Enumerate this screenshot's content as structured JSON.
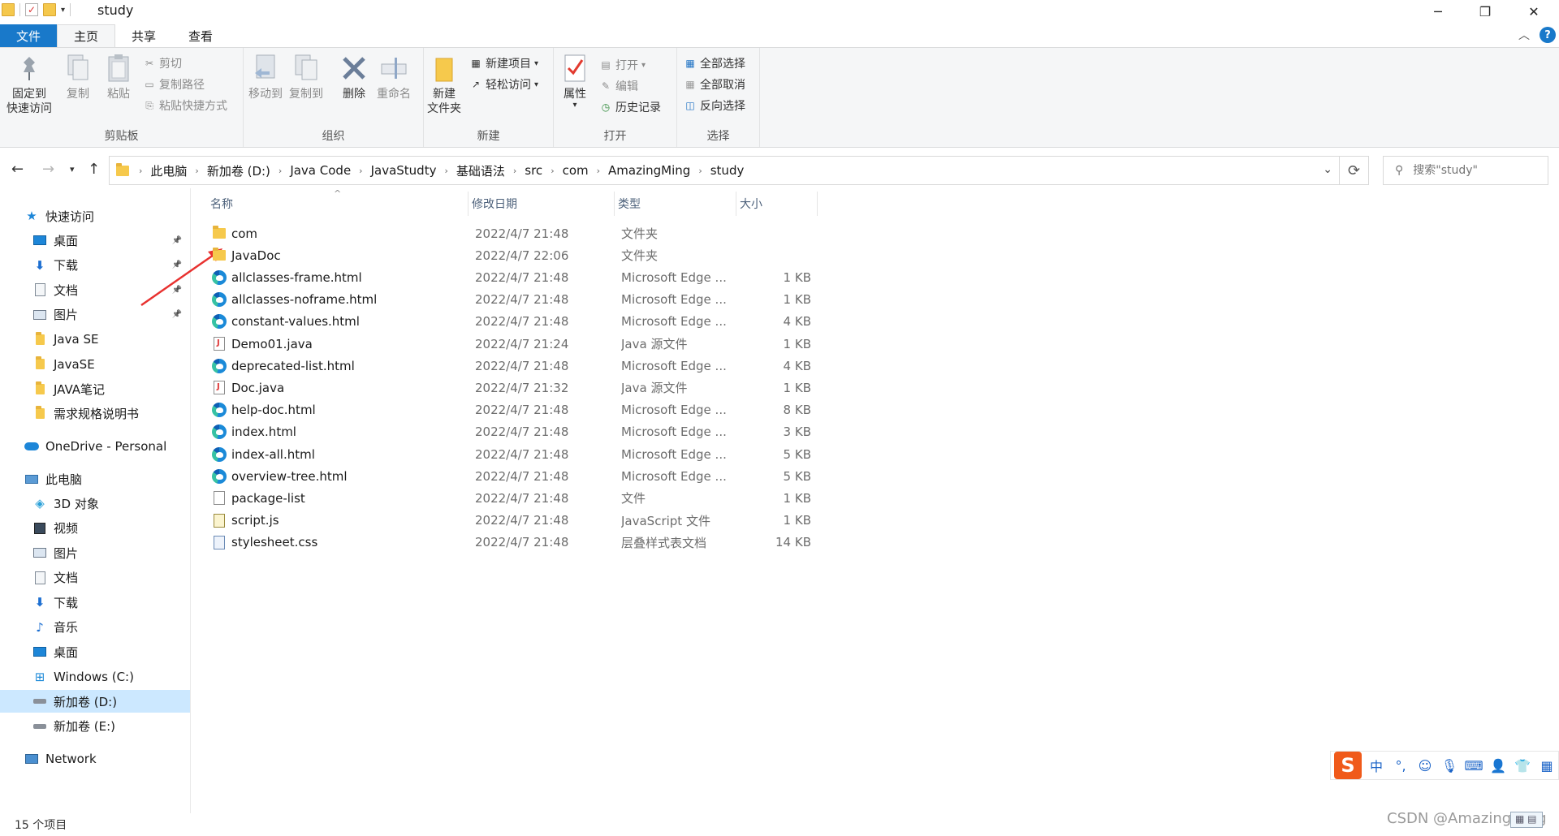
{
  "window": {
    "title": "study",
    "qa_arrow": "▾",
    "minimize": "─",
    "restore": "❐",
    "close": "✕"
  },
  "tabs": {
    "file": "文件",
    "home": "主页",
    "share": "共享",
    "view": "查看"
  },
  "ribbon": {
    "clipboard": {
      "label": "剪贴板",
      "pin_line1": "固定到",
      "pin_line2": "快速访问",
      "copy": "复制",
      "paste": "粘贴",
      "cut": "剪切",
      "copy_path": "复制路径",
      "paste_shortcut": "粘贴快捷方式"
    },
    "organize": {
      "label": "组织",
      "move_to": "移动到",
      "copy_to": "复制到",
      "delete": "删除",
      "rename": "重命名"
    },
    "new": {
      "label": "新建",
      "new_folder_line1": "新建",
      "new_folder_line2": "文件夹",
      "new_item": "新建项目",
      "easy_access": "轻松访问"
    },
    "open": {
      "label": "打开",
      "properties": "属性",
      "open": "打开",
      "edit": "编辑",
      "history": "历史记录"
    },
    "select": {
      "label": "选择",
      "select_all": "全部选择",
      "select_none": "全部取消",
      "invert": "反向选择"
    }
  },
  "address": {
    "crumbs": [
      "此电脑",
      "新加卷 (D:)",
      "Java Code",
      "JavaStudty",
      "基础语法",
      "src",
      "com",
      "AmazingMing",
      "study"
    ],
    "search_placeholder": "搜索\"study\""
  },
  "nav_pane": {
    "quick_access": "快速访问",
    "quick_items": [
      {
        "label": "桌面",
        "icon": "desktop-icon",
        "pinned": true
      },
      {
        "label": "下载",
        "icon": "download-icon",
        "pinned": true
      },
      {
        "label": "文档",
        "icon": "documents-icon",
        "pinned": true
      },
      {
        "label": "图片",
        "icon": "pictures-icon",
        "pinned": true
      },
      {
        "label": "Java SE",
        "icon": "folder-icon",
        "pinned": false
      },
      {
        "label": "JavaSE",
        "icon": "folder-icon",
        "pinned": false
      },
      {
        "label": "JAVA笔记",
        "icon": "folder-icon",
        "pinned": false
      },
      {
        "label": "需求规格说明书",
        "icon": "folder-icon",
        "pinned": false
      }
    ],
    "onedrive": "OneDrive - Personal",
    "this_pc": "此电脑",
    "pc_items": [
      {
        "label": "3D 对象",
        "icon": "3d-objects-icon"
      },
      {
        "label": "视频",
        "icon": "videos-icon"
      },
      {
        "label": "图片",
        "icon": "pictures-icon"
      },
      {
        "label": "文档",
        "icon": "documents-icon"
      },
      {
        "label": "下载",
        "icon": "download-icon"
      },
      {
        "label": "音乐",
        "icon": "music-icon"
      },
      {
        "label": "桌面",
        "icon": "desktop-icon"
      },
      {
        "label": "Windows (C:)",
        "icon": "drive-c-icon"
      },
      {
        "label": "新加卷 (D:)",
        "icon": "drive-icon",
        "selected": true
      },
      {
        "label": "新加卷 (E:)",
        "icon": "drive-icon"
      }
    ],
    "network": "Network"
  },
  "columns": {
    "name": "名称",
    "date": "修改日期",
    "type": "类型",
    "size": "大小"
  },
  "files": [
    {
      "name": "com",
      "date": "2022/4/7 21:48",
      "type": "文件夹",
      "size": "",
      "icon": "folder"
    },
    {
      "name": "JavaDoc",
      "date": "2022/4/7 22:06",
      "type": "文件夹",
      "size": "",
      "icon": "folder"
    },
    {
      "name": "allclasses-frame.html",
      "date": "2022/4/7 21:48",
      "type": "Microsoft Edge ...",
      "size": "1 KB",
      "icon": "edge"
    },
    {
      "name": "allclasses-noframe.html",
      "date": "2022/4/7 21:48",
      "type": "Microsoft Edge ...",
      "size": "1 KB",
      "icon": "edge"
    },
    {
      "name": "constant-values.html",
      "date": "2022/4/7 21:48",
      "type": "Microsoft Edge ...",
      "size": "4 KB",
      "icon": "edge"
    },
    {
      "name": "Demo01.java",
      "date": "2022/4/7 21:24",
      "type": "Java 源文件",
      "size": "1 KB",
      "icon": "java"
    },
    {
      "name": "deprecated-list.html",
      "date": "2022/4/7 21:48",
      "type": "Microsoft Edge ...",
      "size": "4 KB",
      "icon": "edge"
    },
    {
      "name": "Doc.java",
      "date": "2022/4/7 21:32",
      "type": "Java 源文件",
      "size": "1 KB",
      "icon": "java"
    },
    {
      "name": "help-doc.html",
      "date": "2022/4/7 21:48",
      "type": "Microsoft Edge ...",
      "size": "8 KB",
      "icon": "edge"
    },
    {
      "name": "index.html",
      "date": "2022/4/7 21:48",
      "type": "Microsoft Edge ...",
      "size": "3 KB",
      "icon": "edge"
    },
    {
      "name": "index-all.html",
      "date": "2022/4/7 21:48",
      "type": "Microsoft Edge ...",
      "size": "5 KB",
      "icon": "edge"
    },
    {
      "name": "overview-tree.html",
      "date": "2022/4/7 21:48",
      "type": "Microsoft Edge ...",
      "size": "5 KB",
      "icon": "edge"
    },
    {
      "name": "package-list",
      "date": "2022/4/7 21:48",
      "type": "文件",
      "size": "1 KB",
      "icon": "file"
    },
    {
      "name": "script.js",
      "date": "2022/4/7 21:48",
      "type": "JavaScript 文件",
      "size": "1 KB",
      "icon": "js"
    },
    {
      "name": "stylesheet.css",
      "date": "2022/4/7 21:48",
      "type": "层叠样式表文档",
      "size": "14 KB",
      "icon": "css"
    }
  ],
  "status": {
    "count": "15 个项目"
  },
  "ime": {
    "logo": "S",
    "lang": "中",
    "punct": "°,"
  },
  "watermark": "CSDN @AmazingMing"
}
